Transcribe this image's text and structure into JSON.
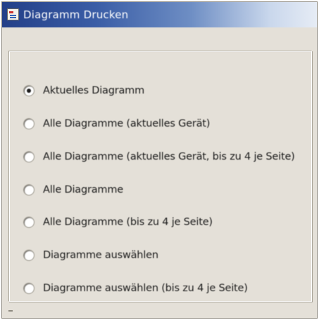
{
  "window": {
    "title": "Diagramm Drucken"
  },
  "options": [
    {
      "label": "Aktuelles Diagramm",
      "checked": true
    },
    {
      "label": "Alle Diagramme (aktuelles Gerät)",
      "checked": false
    },
    {
      "label": "Alle Diagramme (aktuelles Gerät, bis zu 4 je Seite)",
      "checked": false
    },
    {
      "label": "Alle Diagramme",
      "checked": false
    },
    {
      "label": "Alle Diagramme (bis zu 4 je Seite)",
      "checked": false
    },
    {
      "label": "Diagramme auswählen",
      "checked": false
    },
    {
      "label": "Diagramme auswählen (bis zu 4 je Seite)",
      "checked": false
    }
  ],
  "colors": {
    "titlebar_start": "#233f88",
    "titlebar_end": "#e6ecf5",
    "dialog_bg": "#e4e0d8"
  }
}
